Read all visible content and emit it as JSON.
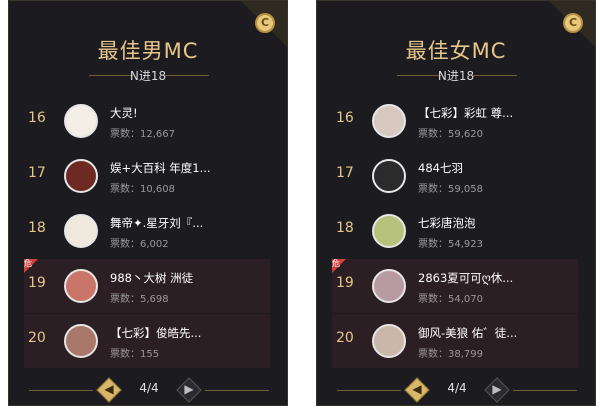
{
  "panels": [
    {
      "title": "最佳男MC",
      "subtitle": "N进18",
      "page": "4/4",
      "rows": [
        {
          "rank": "16",
          "name": "大灵!",
          "votes": "票数：12,667",
          "avatar": "#f3efe6",
          "hl": false
        },
        {
          "rank": "17",
          "name": "娱+大百科 年度1...",
          "votes": "票数：10,608",
          "avatar": "#6e2a22",
          "hl": false
        },
        {
          "rank": "18",
          "name": "舞帝✦.星牙刘『...",
          "votes": "票数：6,002",
          "avatar": "#efe9dd",
          "hl": false
        },
        {
          "rank": "19",
          "name": "988丶大树 洲徒",
          "votes": "票数：5,698",
          "avatar": "#c9756a",
          "hl": true
        },
        {
          "rank": "20",
          "name": "【七彩】俊皓先...",
          "votes": "票数：155",
          "avatar": "#a9786a",
          "hl": true
        }
      ]
    },
    {
      "title": "最佳女MC",
      "subtitle": "N进18",
      "page": "4/4",
      "rows": [
        {
          "rank": "16",
          "name": "【七彩】彩虹 尊...",
          "votes": "票数：59,620",
          "avatar": "#d7c9c0",
          "hl": false
        },
        {
          "rank": "17",
          "name": "484七羽",
          "votes": "票数：59,058",
          "avatar": "#2b2b2b",
          "hl": false
        },
        {
          "rank": "18",
          "name": "七彩唐泡泡",
          "votes": "票数：54,923",
          "avatar": "#b7c27d",
          "hl": false
        },
        {
          "rank": "19",
          "name": "2863夏可可ღ休...",
          "votes": "票数：54,070",
          "avatar": "#b89aa3",
          "hl": true
        },
        {
          "rank": "20",
          "name": "御风-美狼 佑゛徒...",
          "votes": "票数：38,799",
          "avatar": "#c9b7a9",
          "hl": true
        }
      ]
    }
  ],
  "badge_label": "危",
  "coin_icon": "C",
  "pager_prev": "◀",
  "pager_next": "▶",
  "colors": {
    "accent": "#e6c68a",
    "danger": "#d3413a",
    "panel_bg": "#1c1c20"
  }
}
